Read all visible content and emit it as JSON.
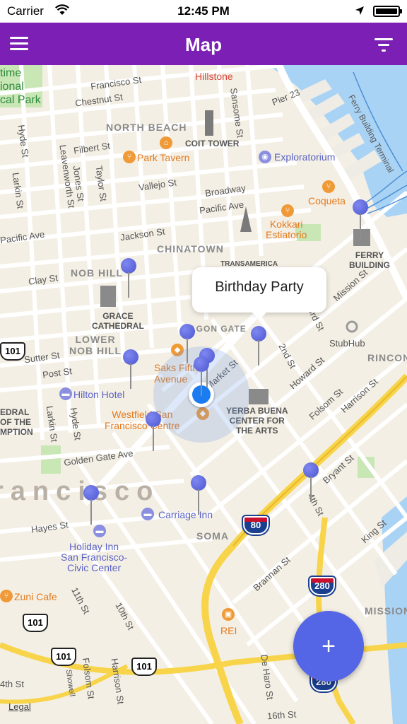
{
  "status": {
    "carrier": "Carrier",
    "time": "12:45 PM"
  },
  "nav": {
    "title": "Map",
    "menu_icon": "hamburger-menu-icon",
    "filter_icon": "filter-icon"
  },
  "callout": {
    "title": "Birthday Party"
  },
  "fab": {
    "label": "+"
  },
  "legal": "Legal",
  "map": {
    "streets": {
      "francisco": "Francisco St",
      "chestnut": "Chestnut St",
      "filbert": "Filbert St",
      "vallejo": "Vallejo St",
      "broadway": "Broadway",
      "pacific": "Pacific Ave",
      "jackson": "Jackson St",
      "clay": "Clay St",
      "sutter": "Sutter St",
      "post": "Post St",
      "golden_gate": "Golden Gate Ave",
      "hayes": "Hayes St",
      "hyde_top": "Hyde St",
      "hyde_mid": "Hyde St",
      "larkin_top": "Larkin St",
      "larkin_mid": "Larkin St",
      "leavenworth": "Leavenworth St",
      "jones": "Jones St",
      "taylor": "Taylor St",
      "sansome": "Sansome St",
      "market": "Market St",
      "mission": "Mission St",
      "second": "2nd St",
      "third": "3rd St",
      "howard": "Howard St",
      "folsom": "Folsom St",
      "harrison": "Harrison St",
      "bryant": "Bryant St",
      "fourth": "4th St",
      "brannan": "Brannan St",
      "king": "King St",
      "tenth": "10th St",
      "eleventh": "11th St",
      "folsom_low": "Folsom St",
      "harrison_low": "Harrison St",
      "de_haro": "De Haro St",
      "sixteenth": "16th St",
      "showell": "Showell",
      "fourth_low": "4th St",
      "pier": "Pier 23",
      "ferry_terminal": "Ferry Building Terminal"
    },
    "districts": {
      "north_beach": "NORTH BEACH",
      "chinatown": "CHINATOWN",
      "nob_hill": "NOB HILL",
      "lower_nob_hill": "LOWER\nNOB HILL",
      "soma": "SOMA",
      "mission": "MISSION",
      "rincon": "RINCON",
      "big_city": "rancisco"
    },
    "pois": {
      "hillstone": "Hillstone",
      "coit": "COIT TOWER",
      "park_tavern": "Park Tavern",
      "exploratorium": "Exploratorium",
      "coqueta": "Coqueta",
      "kokkari": "Kokkari\nEstiatorio",
      "ferry": "FERRY\nBUILDING",
      "transamerica": "TRANSAMERICA\nPYRAMID",
      "grace": "GRACE\nCATHEDRAL",
      "dragon_gate": "AGON GATE",
      "stubhub": "StubHub",
      "saks": "Saks Fifth\nAvenue",
      "hilton": "Hilton Hotel",
      "westfield": "Westfield San\nFrancisco Centre",
      "yerba": "YERBA BUENA\nCENTER FOR\nTHE ARTS",
      "carriage": "Carriage Inn",
      "holiday": "Holiday Inn\nSan Francisco-\nCivic Center",
      "zuni": "Zuni Cafe",
      "rei": "REI",
      "park": "time\nional\ncal Park",
      "edral": "EDRAL\nOF THE\nMPTION"
    },
    "shields": {
      "us101_a": "101",
      "us101_b": "101",
      "us101_c": "101",
      "us101_d": "101",
      "i80": "80",
      "i280_a": "280",
      "i280_b": "280"
    }
  }
}
